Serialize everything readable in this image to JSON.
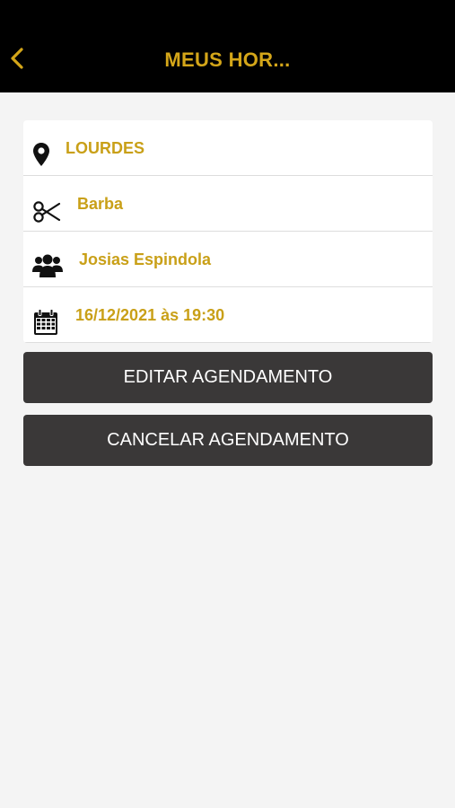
{
  "header": {
    "title": "MEUS HOR...",
    "back_icon": "chevron-left-icon",
    "accent_color": "#d4a619"
  },
  "appointment": {
    "location": "LOURDES",
    "service": "Barba",
    "professional": "Josias Espindola",
    "datetime": "16/12/2021 às 19:30"
  },
  "actions": {
    "edit_label": "EDITAR AGENDAMENTO",
    "cancel_label": "CANCELAR AGENDAMENTO"
  },
  "colors": {
    "header_bg": "#000000",
    "page_bg": "#f4f4f4",
    "value_text": "#c9a018",
    "button_bg": "#3a3838"
  }
}
